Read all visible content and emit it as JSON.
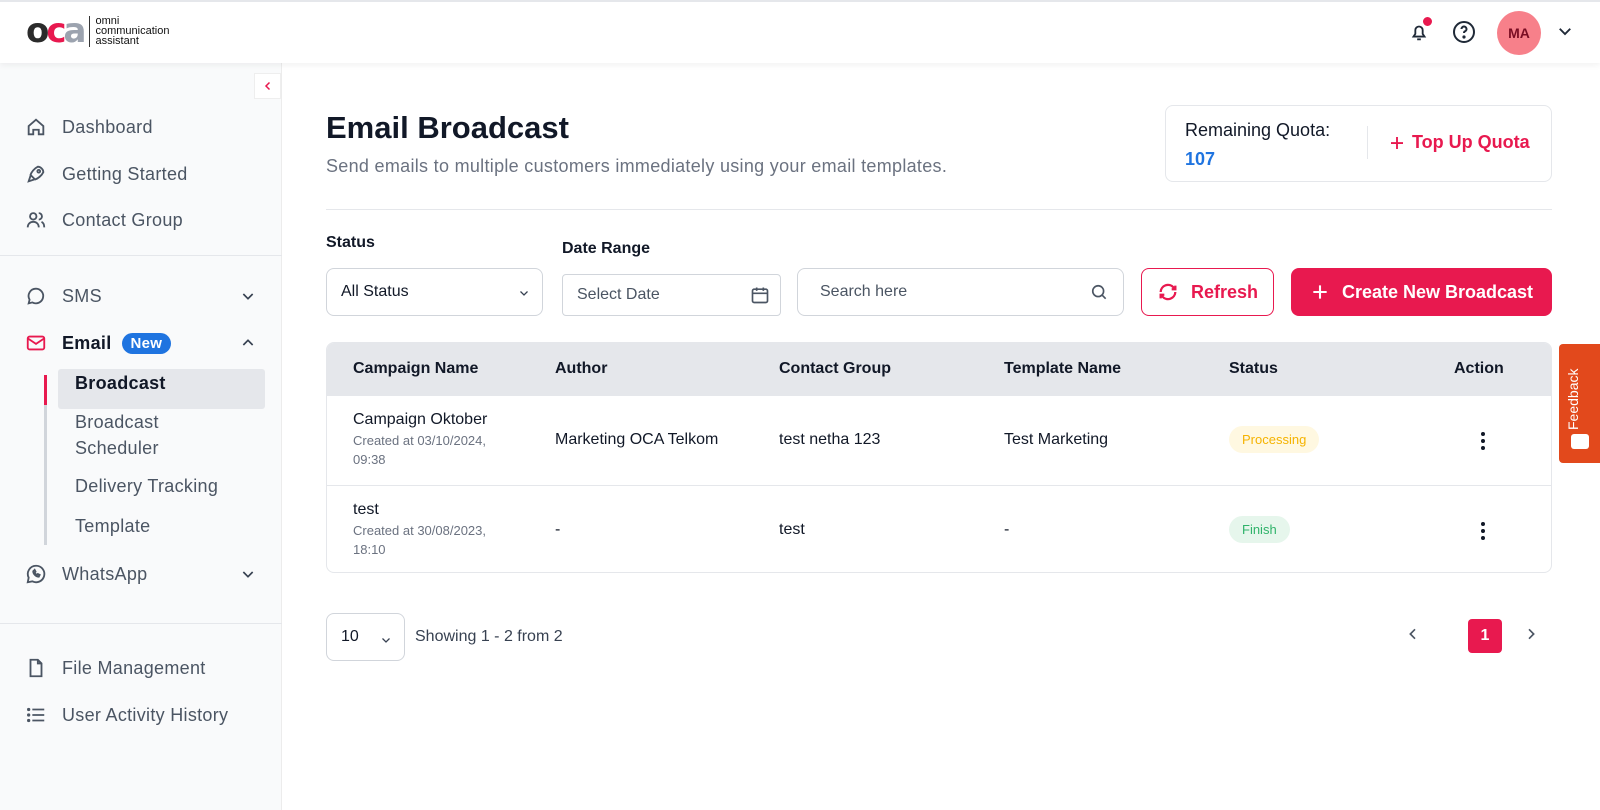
{
  "header": {
    "logo_mark": [
      "o",
      "c",
      "a"
    ],
    "logo_lines": [
      "omni",
      "communication",
      "assistant"
    ],
    "avatar_initials": "MA",
    "accent": "#e8194f"
  },
  "sidebar": {
    "items": [
      {
        "label": "Dashboard",
        "icon": "home-icon"
      },
      {
        "label": "Getting Started",
        "icon": "rocket-icon"
      },
      {
        "label": "Contact Group",
        "icon": "users-icon"
      },
      {
        "label": "SMS",
        "icon": "chat-icon"
      },
      {
        "label": "Email",
        "icon": "mail-icon",
        "badge": "New"
      },
      {
        "label": "WhatsApp",
        "icon": "whatsapp-icon"
      },
      {
        "label": "File Management",
        "icon": "file-icon"
      },
      {
        "label": "User Activity History",
        "icon": "list-icon"
      }
    ],
    "email_sub": [
      "Broadcast",
      "Broadcast",
      "Scheduler",
      "Delivery Tracking",
      "Template"
    ]
  },
  "page": {
    "title": "Email Broadcast",
    "subtitle": "Send emails to multiple customers immediately using your email templates.",
    "quota_label": "Remaining Quota:",
    "quota_value": "107",
    "topup_label": "Top Up Quota"
  },
  "filters": {
    "status_label": "Status",
    "status_value": "All Status",
    "date_label": "Date Range",
    "date_placeholder": "Select Date",
    "search_placeholder": "Search here",
    "refresh_label": "Refresh",
    "create_label": "Create New Broadcast"
  },
  "table": {
    "headers": [
      "Campaign Name",
      "Author",
      "Contact Group",
      "Template Name",
      "Status",
      "Action"
    ],
    "rows": [
      {
        "name": "Campaign Oktober",
        "created1": "Created at 03/10/2024,",
        "created2": "09:38",
        "author": "Marketing OCA Telkom",
        "group": "test netha 123",
        "template": "Test Marketing",
        "status": "Processing"
      },
      {
        "name": "test",
        "created1": "Created at 30/08/2023,",
        "created2": "18:10",
        "author": "-",
        "group": "test",
        "template": "-",
        "status": "Finish"
      }
    ]
  },
  "pagination": {
    "per_page": "10",
    "showing": "Showing 1 - 2 from 2",
    "current_page": "1"
  },
  "feedback_label": "Feedback"
}
